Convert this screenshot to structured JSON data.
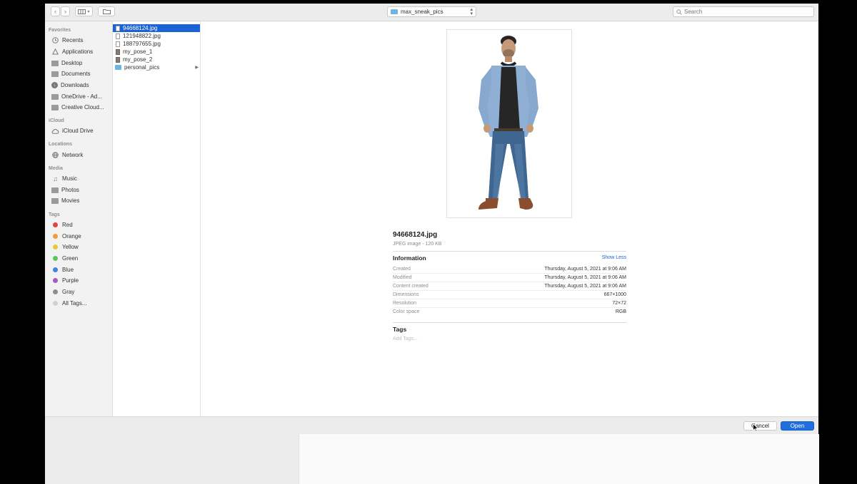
{
  "toolbar": {
    "back_icon": "chevron-left-icon",
    "forward_icon": "chevron-right-icon",
    "view_icon": "column-view-icon",
    "new_folder_icon": "new-folder-icon",
    "path_folder": "max_sneak_pics",
    "search_placeholder": "Search"
  },
  "sidebar": {
    "favorites_title": "Favorites",
    "favorites": [
      {
        "label": "Recents",
        "icon": "recents-icon"
      },
      {
        "label": "Applications",
        "icon": "applications-icon"
      },
      {
        "label": "Desktop",
        "icon": "desktop-icon"
      },
      {
        "label": "Documents",
        "icon": "documents-icon"
      },
      {
        "label": "Downloads",
        "icon": "downloads-icon"
      },
      {
        "label": "OneDrive - Ad...",
        "icon": "folder-icon"
      },
      {
        "label": "Creative Cloud...",
        "icon": "folder-icon"
      }
    ],
    "icloud_title": "iCloud",
    "icloud": [
      {
        "label": "iCloud Drive",
        "icon": "cloud-icon"
      }
    ],
    "locations_title": "Locations",
    "locations": [
      {
        "label": "Network",
        "icon": "globe-icon"
      }
    ],
    "media_title": "Media",
    "media": [
      {
        "label": "Music",
        "icon": "music-icon"
      },
      {
        "label": "Photos",
        "icon": "camera-icon"
      },
      {
        "label": "Movies",
        "icon": "film-icon"
      }
    ],
    "tags_title": "Tags",
    "tags": [
      {
        "label": "Red",
        "color": "#e0443e"
      },
      {
        "label": "Orange",
        "color": "#f39a38"
      },
      {
        "label": "Yellow",
        "color": "#e8c53a"
      },
      {
        "label": "Green",
        "color": "#5bc65b"
      },
      {
        "label": "Blue",
        "color": "#3f83e4"
      },
      {
        "label": "Purple",
        "color": "#a65ac4"
      },
      {
        "label": "Gray",
        "color": "#8e8e93"
      },
      {
        "label": "All Tags...",
        "color": "#d0d0d0"
      }
    ]
  },
  "files": [
    {
      "name": "94668124.jpg",
      "type": "file",
      "selected": true
    },
    {
      "name": "121948822.jpg",
      "type": "file",
      "selected": false
    },
    {
      "name": "188797655.jpg",
      "type": "file",
      "selected": false
    },
    {
      "name": "my_pose_1",
      "type": "photo",
      "selected": false
    },
    {
      "name": "my_pose_2",
      "type": "photo",
      "selected": false
    },
    {
      "name": "personal_pics",
      "type": "folder",
      "selected": false
    }
  ],
  "preview": {
    "filename": "94668124.jpg",
    "subtitle": "JPEG image - 120 KB",
    "info_title": "Information",
    "show_less": "Show Less",
    "info": [
      {
        "key": "Created",
        "value": "Thursday, August 5, 2021 at 9:06 AM"
      },
      {
        "key": "Modified",
        "value": "Thursday, August 5, 2021 at 9:06 AM"
      },
      {
        "key": "Content created",
        "value": "Thursday, August 5, 2021 at 9:06 AM"
      },
      {
        "key": "Dimensions",
        "value": "667×1000"
      },
      {
        "key": "Resolution",
        "value": "72×72"
      },
      {
        "key": "Color space",
        "value": "RGB"
      }
    ],
    "tags_title": "Tags",
    "add_tags_placeholder": "Add Tags..."
  },
  "buttons": {
    "cancel": "Cancel",
    "open": "Open"
  }
}
